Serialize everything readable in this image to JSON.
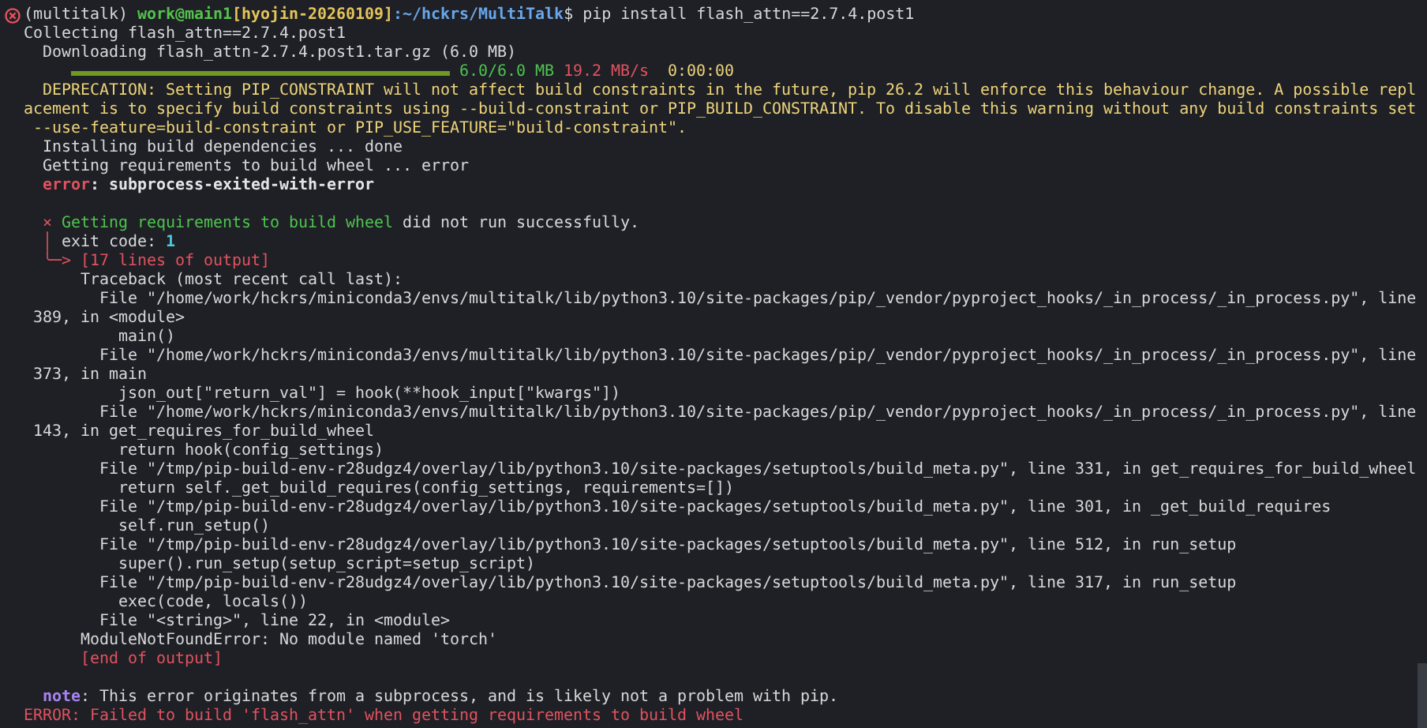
{
  "terminal": {
    "lines": [
      {
        "kind": "prompt",
        "failed": true,
        "segments": [
          {
            "kind": "plain",
            "text": "(multitalk) "
          },
          {
            "kind": "user",
            "text": "work@main1"
          },
          {
            "kind": "host",
            "text": "[hyojin-20260109]"
          },
          {
            "kind": "path",
            "text": ":~/hckrs/MultiTalk"
          },
          {
            "kind": "plain",
            "text": "$ pip install flash_attn==2.7.4.post1"
          }
        ]
      },
      {
        "kind": "text",
        "segments": [
          {
            "kind": "plain",
            "text": "Collecting flash_attn==2.7.4.post1"
          }
        ]
      },
      {
        "kind": "text",
        "segments": [
          {
            "kind": "plain",
            "text": "  Downloading flash_attn-2.7.4.post1.tar.gz (6.0 MB)"
          }
        ]
      },
      {
        "kind": "progress",
        "level": 1,
        "segments": [
          {
            "kind": "success",
            "text": " 6.0/6.0 MB"
          },
          {
            "kind": "speed",
            "text": " 19.2 MB/s"
          },
          {
            "kind": "warning",
            "text": "  0:00:00"
          }
        ]
      },
      {
        "kind": "text",
        "segments": [
          {
            "kind": "warning",
            "text": "  DEPRECATION: Setting PIP_CONSTRAINT will not affect build constraints in the future, pip 26.2 will enforce this behaviour change. A possible repl"
          }
        ]
      },
      {
        "kind": "text",
        "segments": [
          {
            "kind": "warning",
            "text": "acement is to specify build constraints using --build-constraint or PIP_BUILD_CONSTRAINT. To disable this warning without any build constraints set"
          }
        ]
      },
      {
        "kind": "text",
        "segments": [
          {
            "kind": "warning",
            "text": " --use-feature=build-constraint or PIP_USE_FEATURE=\"build-constraint\"."
          }
        ]
      },
      {
        "kind": "text",
        "segments": [
          {
            "kind": "plain",
            "text": "  Installing build dependencies ... done"
          }
        ]
      },
      {
        "kind": "text",
        "segments": [
          {
            "kind": "plain",
            "text": "  Getting requirements to build wheel ... error"
          }
        ]
      },
      {
        "kind": "text",
        "segments": [
          {
            "kind": "error",
            "text": "  error"
          },
          {
            "kind": "strong",
            "text": ": subprocess-exited-with-error"
          }
        ]
      },
      {
        "kind": "blank"
      },
      {
        "kind": "text",
        "segments": [
          {
            "kind": "speed",
            "text": "  × "
          },
          {
            "kind": "success",
            "text": "Getting requirements to build wheel"
          },
          {
            "kind": "plain",
            "text": " did not run successfully."
          }
        ]
      },
      {
        "kind": "text",
        "segments": [
          {
            "kind": "speed",
            "text": "  │"
          },
          {
            "kind": "plain",
            "text": " exit code: "
          },
          {
            "kind": "number",
            "text": "1"
          }
        ]
      },
      {
        "kind": "text",
        "segments": [
          {
            "kind": "speed",
            "text": "  ╰─> [17 lines of output]"
          }
        ]
      },
      {
        "kind": "text",
        "segments": [
          {
            "kind": "plain",
            "text": "      Traceback (most recent call last):"
          }
        ]
      },
      {
        "kind": "text",
        "segments": [
          {
            "kind": "plain",
            "text": "        File \"/home/work/hckrs/miniconda3/envs/multitalk/lib/python3.10/site-packages/pip/_vendor/pyproject_hooks/_in_process/_in_process.py\", line"
          }
        ]
      },
      {
        "kind": "text",
        "segments": [
          {
            "kind": "plain",
            "text": " 389, in <module>"
          }
        ]
      },
      {
        "kind": "text",
        "segments": [
          {
            "kind": "plain",
            "text": "          main()"
          }
        ]
      },
      {
        "kind": "text",
        "segments": [
          {
            "kind": "plain",
            "text": "        File \"/home/work/hckrs/miniconda3/envs/multitalk/lib/python3.10/site-packages/pip/_vendor/pyproject_hooks/_in_process/_in_process.py\", line"
          }
        ]
      },
      {
        "kind": "text",
        "segments": [
          {
            "kind": "plain",
            "text": " 373, in main"
          }
        ]
      },
      {
        "kind": "text",
        "segments": [
          {
            "kind": "plain",
            "text": "          json_out[\"return_val\"] = hook(**hook_input[\"kwargs\"])"
          }
        ]
      },
      {
        "kind": "text",
        "segments": [
          {
            "kind": "plain",
            "text": "        File \"/home/work/hckrs/miniconda3/envs/multitalk/lib/python3.10/site-packages/pip/_vendor/pyproject_hooks/_in_process/_in_process.py\", line"
          }
        ]
      },
      {
        "kind": "text",
        "segments": [
          {
            "kind": "plain",
            "text": " 143, in get_requires_for_build_wheel"
          }
        ]
      },
      {
        "kind": "text",
        "segments": [
          {
            "kind": "plain",
            "text": "          return hook(config_settings)"
          }
        ]
      },
      {
        "kind": "text",
        "segments": [
          {
            "kind": "plain",
            "text": "        File \"/tmp/pip-build-env-r28udgz4/overlay/lib/python3.10/site-packages/setuptools/build_meta.py\", line 331, in get_requires_for_build_wheel"
          }
        ]
      },
      {
        "kind": "text",
        "segments": [
          {
            "kind": "plain",
            "text": "          return self._get_build_requires(config_settings, requirements=[])"
          }
        ]
      },
      {
        "kind": "text",
        "segments": [
          {
            "kind": "plain",
            "text": "        File \"/tmp/pip-build-env-r28udgz4/overlay/lib/python3.10/site-packages/setuptools/build_meta.py\", line 301, in _get_build_requires"
          }
        ]
      },
      {
        "kind": "text",
        "segments": [
          {
            "kind": "plain",
            "text": "          self.run_setup()"
          }
        ]
      },
      {
        "kind": "text",
        "segments": [
          {
            "kind": "plain",
            "text": "        File \"/tmp/pip-build-env-r28udgz4/overlay/lib/python3.10/site-packages/setuptools/build_meta.py\", line 512, in run_setup"
          }
        ]
      },
      {
        "kind": "text",
        "segments": [
          {
            "kind": "plain",
            "text": "          super().run_setup(setup_script=setup_script)"
          }
        ]
      },
      {
        "kind": "text",
        "segments": [
          {
            "kind": "plain",
            "text": "        File \"/tmp/pip-build-env-r28udgz4/overlay/lib/python3.10/site-packages/setuptools/build_meta.py\", line 317, in run_setup"
          }
        ]
      },
      {
        "kind": "text",
        "segments": [
          {
            "kind": "plain",
            "text": "          exec(code, locals())"
          }
        ]
      },
      {
        "kind": "text",
        "segments": [
          {
            "kind": "plain",
            "text": "        File \"<string>\", line 22, in <module>"
          }
        ]
      },
      {
        "kind": "text",
        "segments": [
          {
            "kind": "plain",
            "text": "      ModuleNotFoundError: No module named 'torch'"
          }
        ]
      },
      {
        "kind": "text",
        "segments": [
          {
            "kind": "speed",
            "text": "      [end of output]"
          }
        ]
      },
      {
        "kind": "blank"
      },
      {
        "kind": "text",
        "segments": [
          {
            "kind": "note",
            "text": "  note"
          },
          {
            "kind": "plain",
            "text": ": This error originates from a subprocess, and is likely not a problem with pip."
          }
        ]
      },
      {
        "kind": "text",
        "segments": [
          {
            "kind": "speed",
            "text": "ERROR: Failed to build 'flash_attn' when getting requirements to build wheel"
          }
        ]
      }
    ]
  }
}
